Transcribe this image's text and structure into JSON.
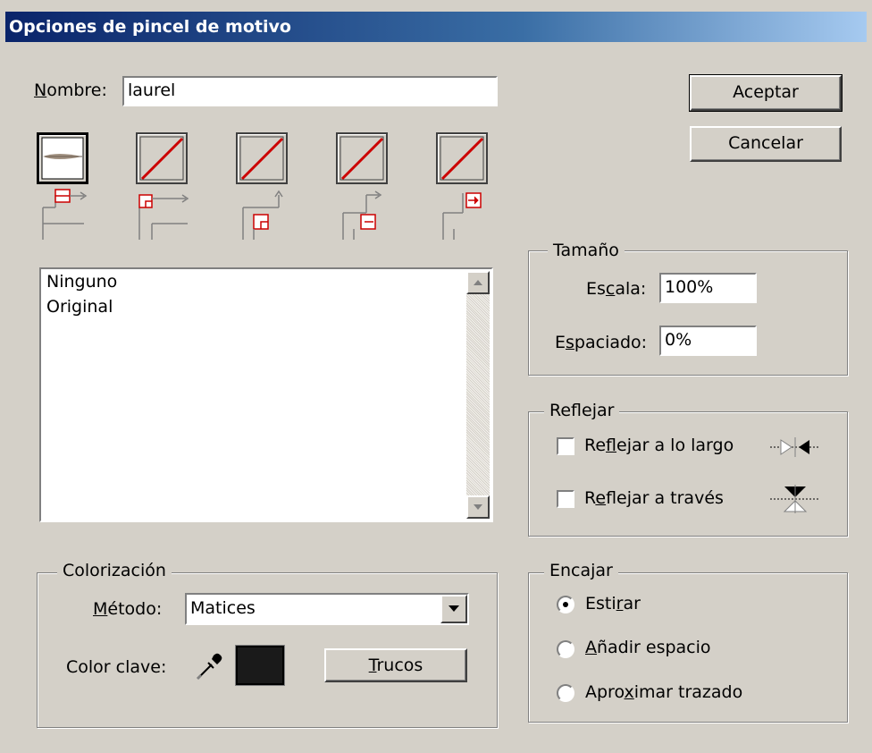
{
  "window": {
    "title": "Opciones de pincel de motivo"
  },
  "name_row": {
    "label": "N",
    "label_rest": "ombre:",
    "value": "laurel"
  },
  "buttons": {
    "ok": "Aceptar",
    "cancel": "Cancelar",
    "tips_u": "T",
    "tips_rest": "rucos"
  },
  "tiles": [
    {
      "id": "side",
      "selected": true,
      "type": "pattern"
    },
    {
      "id": "outer-corner",
      "selected": false,
      "type": "none"
    },
    {
      "id": "inner-corner",
      "selected": false,
      "type": "none"
    },
    {
      "id": "start",
      "selected": false,
      "type": "none"
    },
    {
      "id": "end",
      "selected": false,
      "type": "none"
    }
  ],
  "pattern_list": {
    "items": [
      "Ninguno",
      "Original"
    ]
  },
  "tamano": {
    "title": "Tamaño",
    "escala_label_a": "Es",
    "escala_label_u": "c",
    "escala_label_b": "ala:",
    "escala_value": "100%",
    "espaciado_label_a": "E",
    "espaciado_label_u": "s",
    "espaciado_label_b": "paciado:",
    "espaciado_value": "0%"
  },
  "reflejar": {
    "title": "Reflejar",
    "along_a": "Re",
    "along_u": "f",
    "along_b": "lejar a lo largo",
    "across_a": "R",
    "across_u": "e",
    "across_b": "flejar a través",
    "along_checked": false,
    "across_checked": false
  },
  "encajar": {
    "title": "Encajar",
    "stretch_a": "Esti",
    "stretch_u": "r",
    "stretch_b": "ar",
    "add_u": "A",
    "add_b": "ñadir espacio",
    "approx_a": "Apro",
    "approx_u": "x",
    "approx_b": "imar trazado",
    "selected": "stretch"
  },
  "colorizacion": {
    "title": "Colorización",
    "method_u": "M",
    "method_rest": "étodo:",
    "method_value": "Matices",
    "key_color_label": "Color clave:",
    "key_color": "#1a1a1a"
  },
  "colors": {
    "accent_red": "#cc0000"
  }
}
